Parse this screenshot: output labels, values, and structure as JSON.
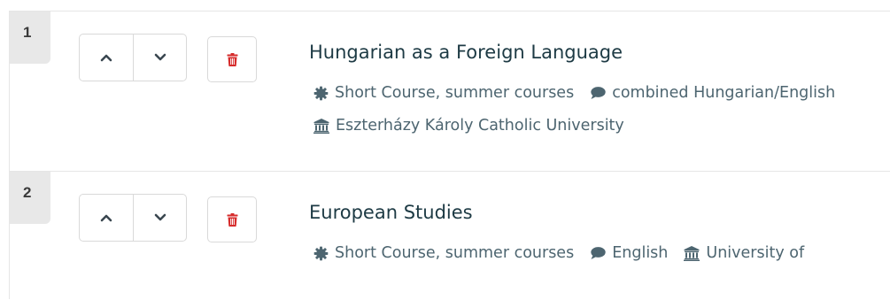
{
  "courses": [
    {
      "number": "1",
      "title": "Hungarian as a Foreign Language",
      "type": "Short Course, summer courses",
      "language": "combined Hungarian/English",
      "institution": "Eszterházy Károly Catholic University"
    },
    {
      "number": "2",
      "title": "European Studies",
      "type": "Short Course, summer courses",
      "language": "English",
      "institution": "University of"
    }
  ],
  "icons": {
    "move_up": "chevron-up-icon",
    "move_down": "chevron-down-icon",
    "delete": "trash-icon",
    "course_type": "gear-icon",
    "language": "speech-bubble-icon",
    "institution": "university-icon"
  },
  "colors": {
    "title": "#1d3a44",
    "meta_text": "#4d6570",
    "delete_icon": "#d62b2b",
    "badge_bg": "#e8e8e8",
    "border": "#d9d9d9"
  }
}
